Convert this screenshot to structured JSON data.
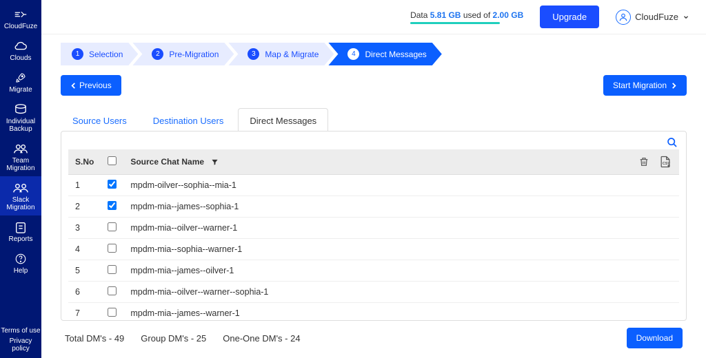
{
  "sidebar": {
    "items": [
      {
        "label": "CloudFuze"
      },
      {
        "label": "Clouds"
      },
      {
        "label": "Migrate"
      },
      {
        "label": "Individual Backup"
      },
      {
        "label": "Team Migration"
      },
      {
        "label": "Slack Migration"
      },
      {
        "label": "Reports"
      },
      {
        "label": "Help"
      }
    ],
    "footer": {
      "terms": "Terms of use",
      "privacy": "Privacy policy"
    }
  },
  "topbar": {
    "data_prefix": "Data",
    "data_used": "5.81 GB",
    "data_mid": "used of",
    "data_total": "2.00 GB",
    "upgrade": "Upgrade",
    "account_name": "CloudFuze"
  },
  "stepper": [
    {
      "num": "1",
      "label": "Selection"
    },
    {
      "num": "2",
      "label": "Pre-Migration"
    },
    {
      "num": "3",
      "label": "Map & Migrate"
    },
    {
      "num": "4",
      "label": "Direct Messages"
    }
  ],
  "actions": {
    "previous": "Previous",
    "start": "Start Migration"
  },
  "tabs": [
    {
      "label": "Source Users"
    },
    {
      "label": "Destination Users"
    },
    {
      "label": "Direct Messages"
    }
  ],
  "table": {
    "header": {
      "sno": "S.No",
      "chat": "Source Chat Name"
    },
    "rows": [
      {
        "no": "1",
        "checked": true,
        "name": "mpdm-oilver--sophia--mia-1"
      },
      {
        "no": "2",
        "checked": true,
        "name": "mpdm-mia--james--sophia-1"
      },
      {
        "no": "3",
        "checked": false,
        "name": "mpdm-mia--oilver--warner-1"
      },
      {
        "no": "4",
        "checked": false,
        "name": "mpdm-mia--sophia--warner-1"
      },
      {
        "no": "5",
        "checked": false,
        "name": "mpdm-mia--james--oilver-1"
      },
      {
        "no": "6",
        "checked": false,
        "name": "mpdm-mia--oilver--warner--sophia-1"
      },
      {
        "no": "7",
        "checked": false,
        "name": "mpdm-mia--james--warner-1"
      }
    ]
  },
  "summary": {
    "total": "Total DM's - 49",
    "group": "Group DM's - 25",
    "oneone": "One-One DM's - 24",
    "download": "Download"
  }
}
